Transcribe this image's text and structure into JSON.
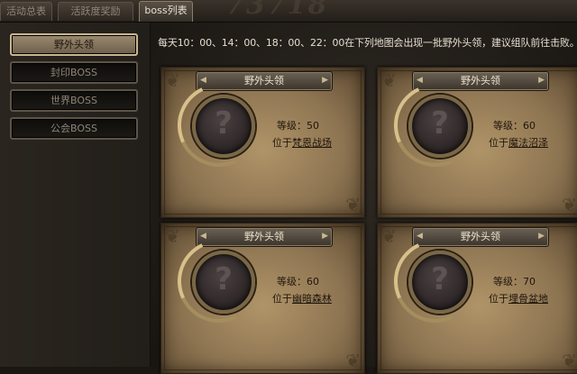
{
  "tabs": [
    {
      "label": "活动总表",
      "active": false
    },
    {
      "label": "活跃度奖励",
      "active": false
    },
    {
      "label": "boss列表",
      "active": true
    }
  ],
  "background_digits": "73718",
  "sidebar": {
    "items": [
      {
        "label": "野外头领",
        "active": true
      },
      {
        "label": "封印BOSS",
        "active": false
      },
      {
        "label": "世界BOSS",
        "active": false
      },
      {
        "label": "公会BOSS",
        "active": false
      }
    ]
  },
  "notice": "每天10：00、14：00、18：00、22：00在下列地图会出现一批野外头领，建议组队前往击败。",
  "cards": [
    {
      "title": "野外头领",
      "level_label": "等级：",
      "level": "50",
      "location_prefix": "位于",
      "location": "梵恩战场",
      "portrait": "unknown-boss"
    },
    {
      "title": "野外头领",
      "level_label": "等级：",
      "level": "60",
      "location_prefix": "位于",
      "location": "魔法沼泽",
      "portrait": "unknown-boss"
    },
    {
      "title": "野外头领",
      "level_label": "等级：",
      "level": "60",
      "location_prefix": "位于",
      "location": "幽暗森林",
      "portrait": "unknown-boss"
    },
    {
      "title": "野外头领",
      "level_label": "等级：",
      "level": "70",
      "location_prefix": "位于",
      "location": "埋骨盆地",
      "portrait": "unknown-boss"
    }
  ]
}
